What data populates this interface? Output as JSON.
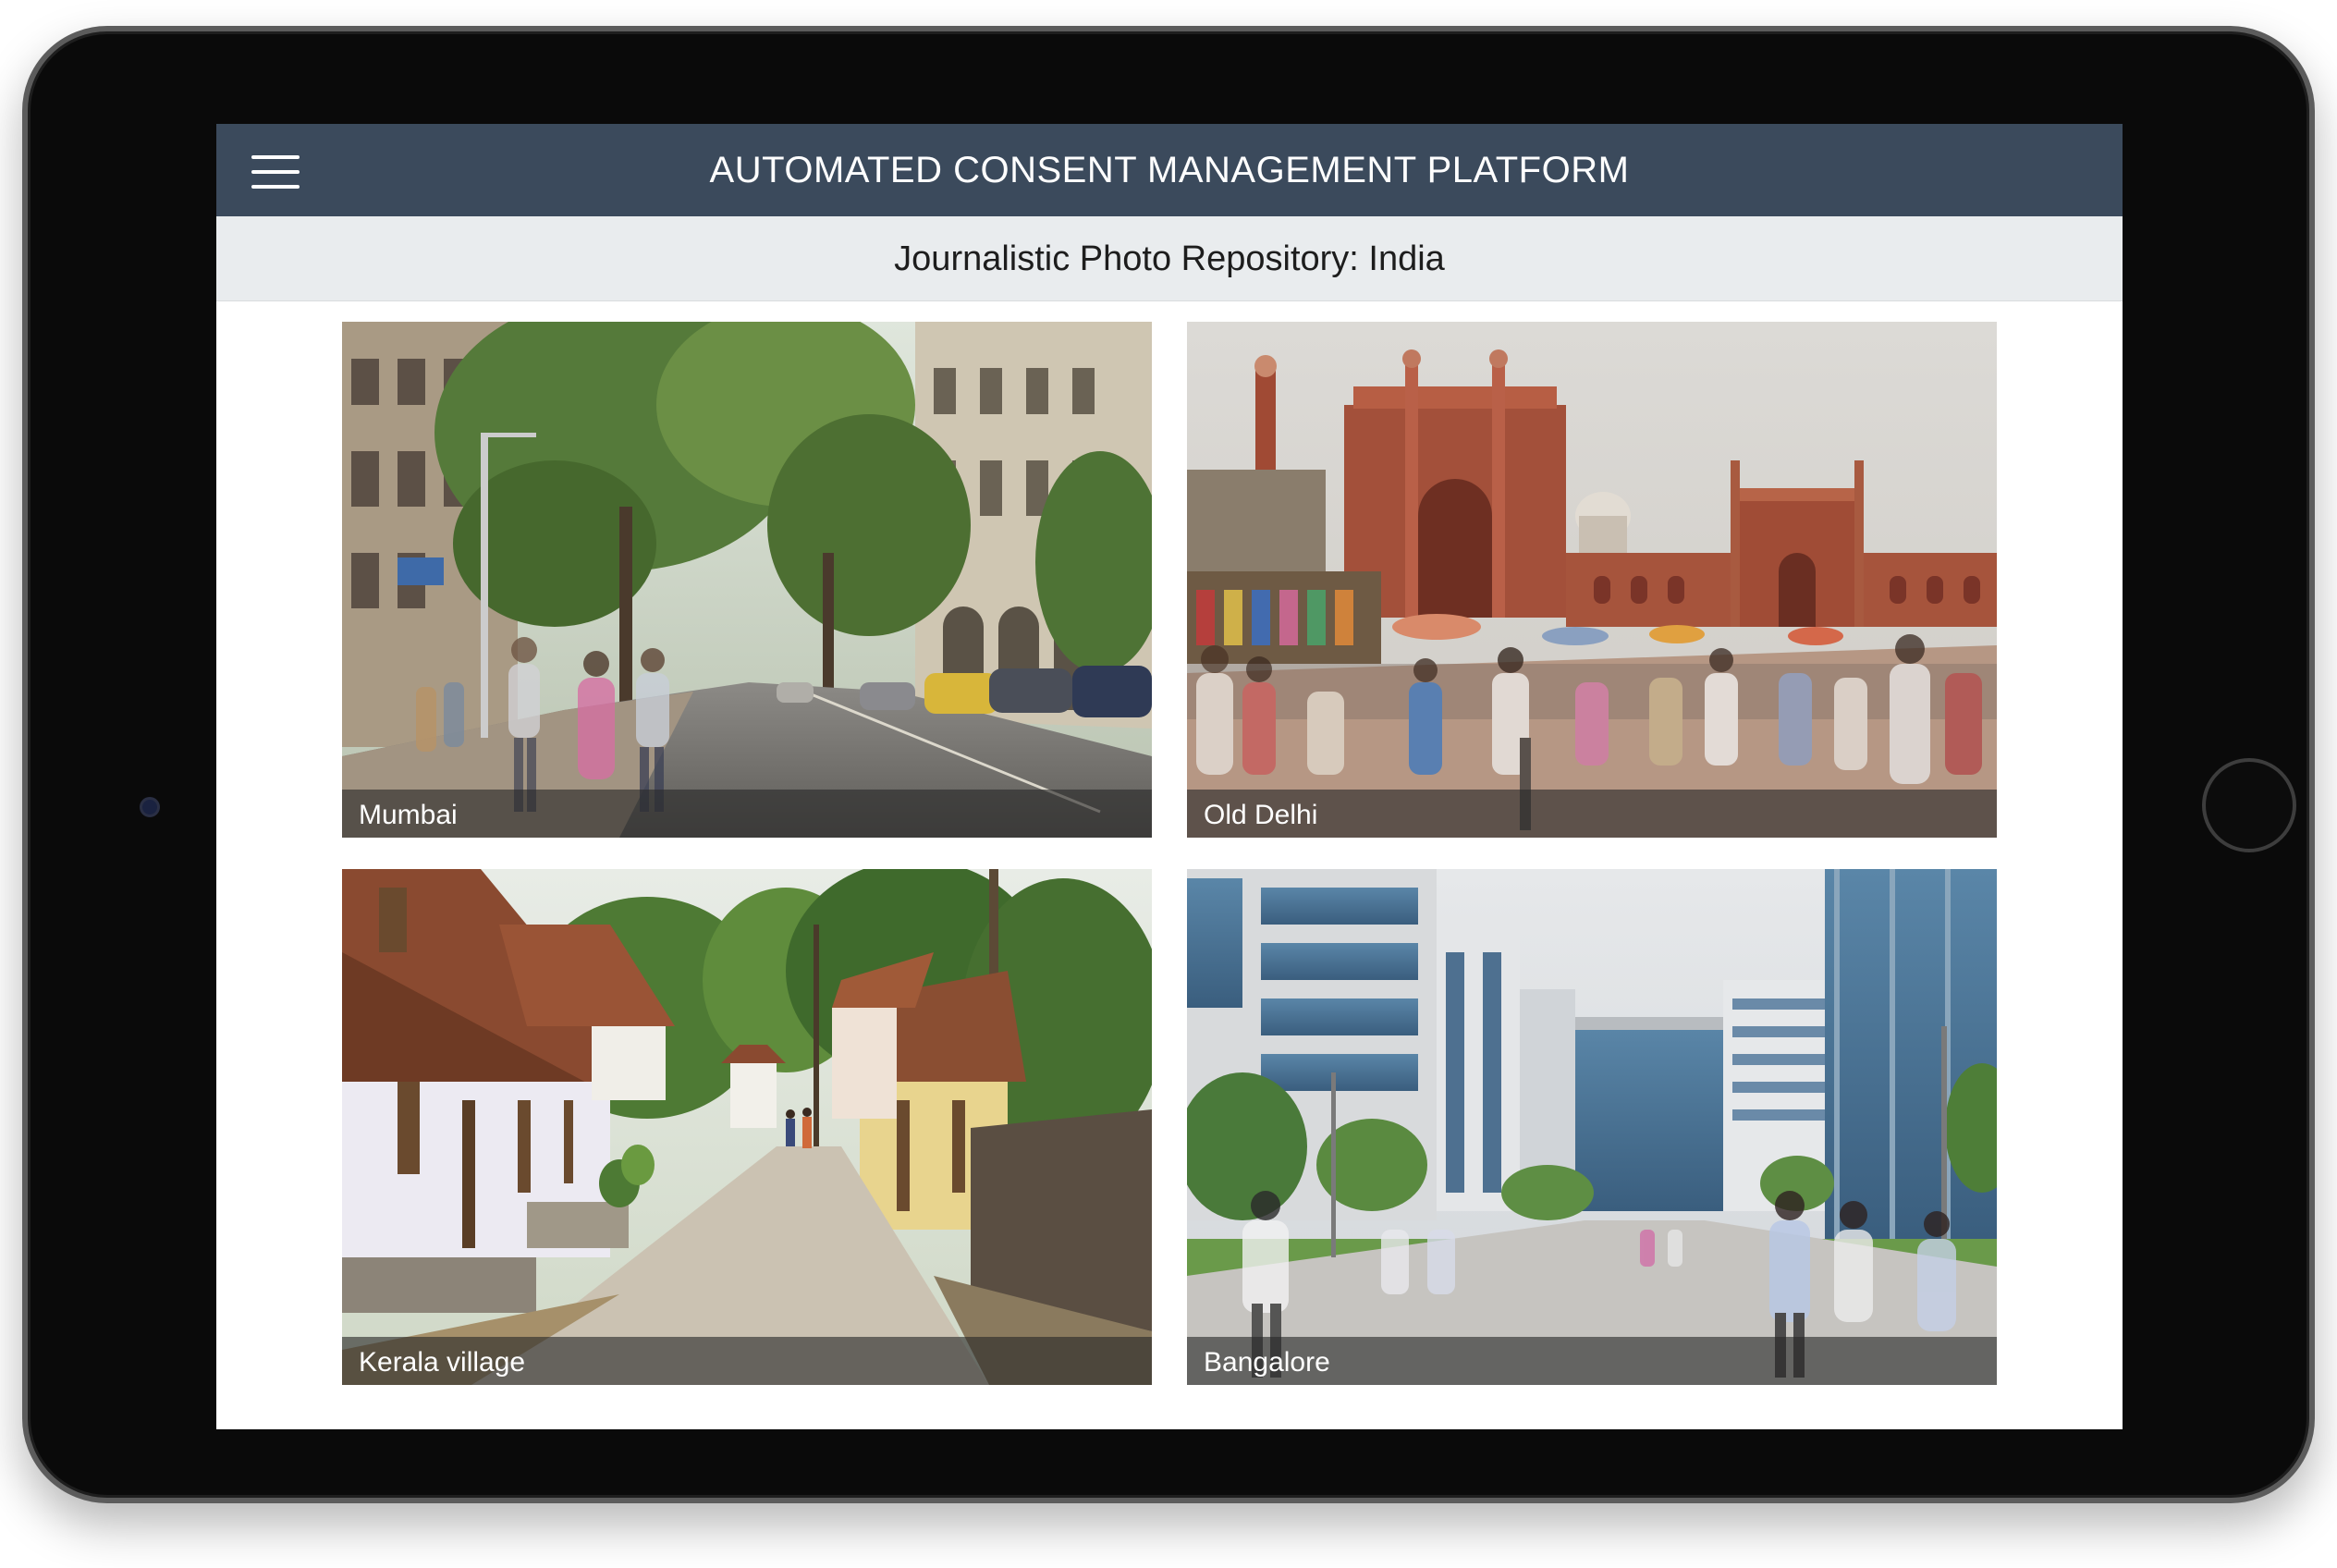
{
  "header": {
    "title": "AUTOMATED CONSENT MANAGEMENT PLATFORM",
    "menu_icon": "hamburger-menu-icon",
    "background_color": "#3b4a5c"
  },
  "subheader": {
    "title": "Journalistic Photo Repository: India"
  },
  "gallery": {
    "photos": [
      {
        "caption": "Mumbai",
        "scene": "tree-lined street with colonial buildings and blurred pedestrians"
      },
      {
        "caption": "Old Delhi",
        "scene": "red sandstone mosque with crowded market and blurred pedestrians"
      },
      {
        "caption": "Kerala village",
        "scene": "quiet lane with tiled-roof houses and palm trees"
      },
      {
        "caption": "Bangalore",
        "scene": "office campus with glass towers and blurred pedestrians"
      }
    ]
  }
}
